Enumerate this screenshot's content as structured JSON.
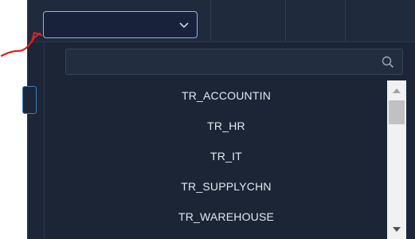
{
  "select": {
    "value": "",
    "chevron_icon": "chevron-down-icon"
  },
  "dropdown": {
    "search": {
      "placeholder": "",
      "value": "",
      "icon": "search-icon"
    },
    "options": [
      {
        "label": "TR_ACCOUNTIN"
      },
      {
        "label": "TR_HR"
      },
      {
        "label": "TR_IT"
      },
      {
        "label": "TR_SUPPLYCHN"
      },
      {
        "label": "TR_WAREHOUSE"
      }
    ]
  },
  "colors": {
    "background": "#1c2638",
    "select_border": "#93b4de",
    "option_text": "#e3e8f0",
    "annotation": "#e02020"
  }
}
